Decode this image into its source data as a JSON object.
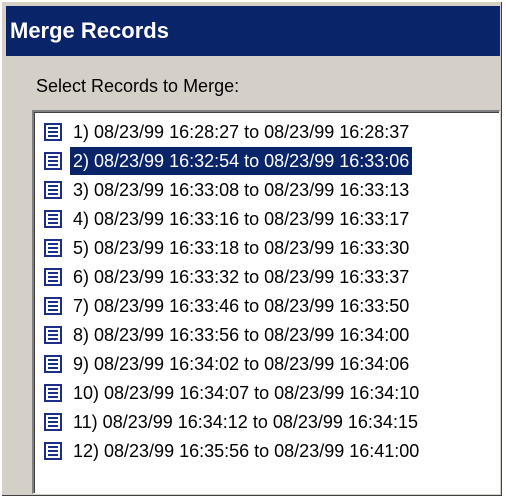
{
  "window": {
    "title": "Merge Records"
  },
  "prompt": "Select Records to Merge:",
  "records": [
    "1) 08/23/99 16:28:27 to 08/23/99 16:28:37",
    "2) 08/23/99 16:32:54 to 08/23/99 16:33:06",
    "3) 08/23/99 16:33:08 to 08/23/99 16:33:13",
    "4) 08/23/99 16:33:16 to 08/23/99 16:33:17",
    "5) 08/23/99 16:33:18 to 08/23/99 16:33:30",
    "6) 08/23/99 16:33:32 to 08/23/99 16:33:37",
    "7) 08/23/99 16:33:46 to 08/23/99 16:33:50",
    "8) 08/23/99 16:33:56 to 08/23/99 16:34:00",
    "9) 08/23/99 16:34:02 to 08/23/99 16:34:06",
    "10) 08/23/99 16:34:07 to 08/23/99 16:34:10",
    "11) 08/23/99 16:34:12 to 08/23/99 16:34:15",
    "12) 08/23/99 16:35:56 to 08/23/99 16:41:00"
  ],
  "selected_index": 1,
  "colors": {
    "titlebar": "#0a246a",
    "selection": "#0a246a",
    "dialog": "#d4d0c8"
  },
  "icon": "record-document-icon"
}
